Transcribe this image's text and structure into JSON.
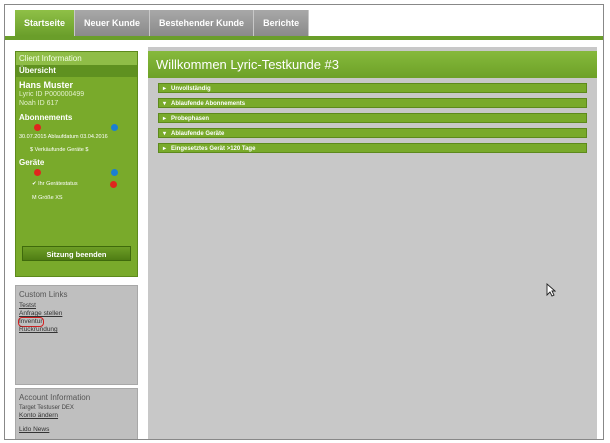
{
  "tabs": [
    "Startseite",
    "Neuer Kunde",
    "Bestehender Kunde",
    "Berichte"
  ],
  "sidebar": {
    "client_info_title": "Client Information",
    "overview_title": "Übersicht",
    "customer_name": "Hans Muster",
    "lyric_id": "Lyric ID P000000499",
    "noah_id": "Noah ID 617",
    "subscriptions_title": "Abonnements",
    "subscription_dates": "30.07.2015  Ablaufdatum  03.04.2016",
    "sales_hearing": "$  Verkäufunde  Geräte  $",
    "devices_title": "Geräte",
    "legend_line": "Ihr Gerätestatus",
    "size_row": "M      Größe      XS",
    "end_session_button": "Sitzung beenden",
    "custom_links_title": "Custom Links",
    "links": [
      "Testst",
      "Anfrage stellen",
      "Inventur",
      "Rückrundung"
    ],
    "account_title": "Account Information",
    "account_name": "Target Testuser DEX",
    "account_edit": "Konto ändern",
    "logout": "Lido News"
  },
  "main": {
    "welcome": "Willkommen Lyric-Testkunde #3",
    "sections": [
      {
        "arrow": "▸",
        "label": "Unvollständig"
      },
      {
        "arrow": "▾",
        "label": "Ablaufende Abonnements"
      },
      {
        "arrow": "▸",
        "label": "Probephasen"
      },
      {
        "arrow": "▾",
        "label": "Ablaufende Geräte"
      },
      {
        "arrow": "▸",
        "label": "Eingesetztes Gerät >120 Tage"
      }
    ]
  },
  "colors": {
    "accent": "#79aa2b",
    "dark_accent": "#5d8a1c",
    "tab_grey": "#9a9a9a",
    "content_bg": "#c8c8c8"
  },
  "icons": {
    "cursor": "mouse-pointer-icon",
    "status_red": "red-dot-icon",
    "status_blue": "blue-dot-icon"
  }
}
